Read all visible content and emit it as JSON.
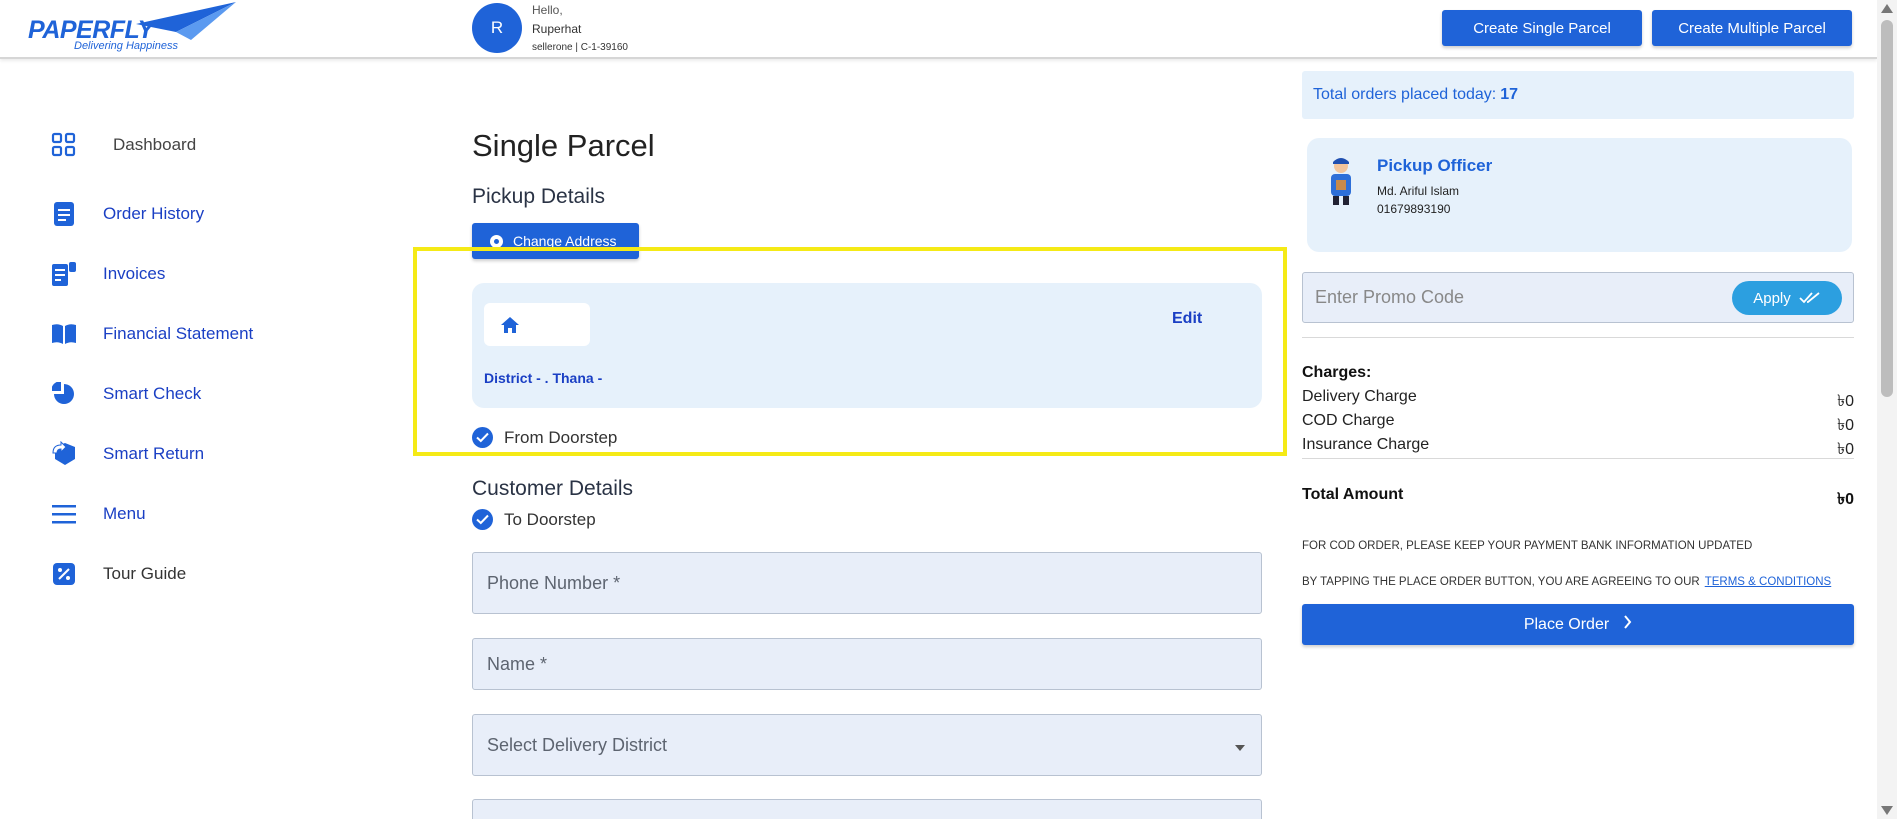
{
  "header": {
    "logo_text": "PAPERFLY",
    "logo_tagline": "Delivering Happiness",
    "avatar_letter": "R",
    "greeting": "Hello,",
    "user_name": "Ruperhat",
    "user_sub": "sellerone | C-1-39160",
    "btn_single": "Create Single Parcel",
    "btn_multiple": "Create Multiple Parcel"
  },
  "sidebar": {
    "items": [
      {
        "label": "Dashboard",
        "icon": "grid-icon"
      },
      {
        "label": "Order History",
        "icon": "document-icon"
      },
      {
        "label": "Invoices",
        "icon": "invoice-icon"
      },
      {
        "label": "Financial Statement",
        "icon": "book-icon"
      },
      {
        "label": "Smart Check",
        "icon": "pie-icon"
      },
      {
        "label": "Smart Return",
        "icon": "return-icon"
      },
      {
        "label": "Menu",
        "icon": "menu-icon"
      },
      {
        "label": "Tour Guide",
        "icon": "percent-icon"
      }
    ]
  },
  "main": {
    "title": "Single Parcel",
    "pickup_title": "Pickup Details",
    "change_address": "Change Address",
    "edit": "Edit",
    "district_line": "District - . Thana -",
    "from_doorstep": "From Doorstep",
    "customer_title": "Customer Details",
    "to_doorstep": "To Doorstep",
    "phone_placeholder": "Phone Number *",
    "name_placeholder": "Name *",
    "district_placeholder": "Select Delivery District"
  },
  "summary": {
    "orders_today_label": "Total orders placed today:",
    "orders_today_count": "17",
    "officer_title": "Pickup Officer",
    "officer_name": "Md. Ariful Islam",
    "officer_phone": "01679893190",
    "promo_placeholder": "Enter Promo Code",
    "apply": "Apply",
    "charges_title": "Charges:",
    "charges": [
      {
        "label": "Delivery Charge",
        "value": "৳0"
      },
      {
        "label": "COD Charge",
        "value": "৳0"
      },
      {
        "label": "Insurance Charge",
        "value": "৳0"
      }
    ],
    "total_label": "Total Amount",
    "total_value": "৳0",
    "note_cod": "FOR COD ORDER, PLEASE KEEP YOUR PAYMENT BANK INFORMATION UPDATED",
    "note_terms": "BY TAPPING THE PLACE ORDER BUTTON, YOU ARE AGREEING TO OUR",
    "terms_link": "TERMS & CONDITIONS",
    "place_order": "Place Order"
  },
  "colors": {
    "primary": "#1f63d8",
    "light_panel": "#e6f1fb",
    "highlight": "#f5ea16"
  }
}
